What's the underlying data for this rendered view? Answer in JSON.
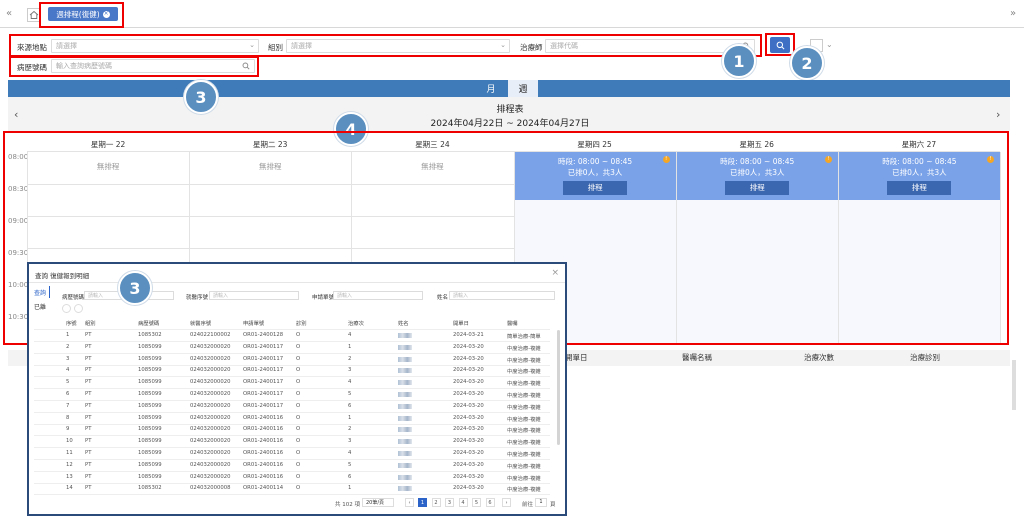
{
  "topbar": {
    "left_arrow": "«",
    "right_arrow": "»",
    "tab_label": "週排程(復健)",
    "tab_close": "×"
  },
  "filters": {
    "source_label": "來源地點",
    "source_placeholder": "請選擇",
    "group_label": "組別",
    "group_placeholder": "請選擇",
    "therapist_label": "治療師",
    "therapist_placeholder": "選擇代碼",
    "chart_label": "病歷號碼",
    "chart_placeholder": "輸入查詢病歷號碼"
  },
  "callouts": [
    "1",
    "2",
    "3",
    "4",
    "3"
  ],
  "view_tabs": {
    "month": "月",
    "week": "週"
  },
  "schedule": {
    "title": "排程表",
    "range": "2024年04月22日 ~ 2024年04月27日",
    "days": [
      "星期一 22",
      "星期二 23",
      "星期三 24",
      "星期四 25",
      "星期五 26",
      "星期六 27"
    ],
    "times": [
      "08:00",
      "08:30",
      "09:00",
      "09:30",
      "10:00",
      "10:30"
    ],
    "no_schedule": "無排程",
    "slot_time": "時段: 08:00 ~ 08:45",
    "slot_count": "已排0人，共3人",
    "slot_button": "排程"
  },
  "bottom_headers": [
    "開單日",
    "醫囑名稱",
    "治療次數",
    "治療診別"
  ],
  "modal": {
    "title": "查詢 復健報到明細",
    "close": "×",
    "side_query": "查詢",
    "side_done": "已離",
    "f1_label": "病歷號碼",
    "f2_label": "就醫序號",
    "f3_label": "申請單號",
    "f4_label": "姓名",
    "placeholder": "請輸入",
    "headers": [
      "序號",
      "組別",
      "病歷號碼",
      "就醫序號",
      "申請單號",
      "診別",
      "治療次",
      "姓名",
      "開單日",
      "醫囑"
    ],
    "rows": [
      [
        "1",
        "PT",
        "1085302",
        "024022100002",
        "OR01-2400128",
        "O",
        "4",
        "2024-03-21",
        "簡單治療-簡單"
      ],
      [
        "2",
        "PT",
        "1085099",
        "024032000020",
        "OR01-2400117",
        "O",
        "1",
        "2024-03-20",
        "中度治療-複雜"
      ],
      [
        "3",
        "PT",
        "1085099",
        "024032000020",
        "OR01-2400117",
        "O",
        "2",
        "2024-03-20",
        "中度治療-複雜"
      ],
      [
        "4",
        "PT",
        "1085099",
        "024032000020",
        "OR01-2400117",
        "O",
        "3",
        "2024-03-20",
        "中度治療-複雜"
      ],
      [
        "5",
        "PT",
        "1085099",
        "024032000020",
        "OR01-2400117",
        "O",
        "4",
        "2024-03-20",
        "中度治療-複雜"
      ],
      [
        "6",
        "PT",
        "1085099",
        "024032000020",
        "OR01-2400117",
        "O",
        "5",
        "2024-03-20",
        "中度治療-複雜"
      ],
      [
        "7",
        "PT",
        "1085099",
        "024032000020",
        "OR01-2400117",
        "O",
        "6",
        "2024-03-20",
        "中度治療-複雜"
      ],
      [
        "8",
        "PT",
        "1085099",
        "024032000020",
        "OR01-2400116",
        "O",
        "1",
        "2024-03-20",
        "中度治療-複雜"
      ],
      [
        "9",
        "PT",
        "1085099",
        "024032000020",
        "OR01-2400116",
        "O",
        "2",
        "2024-03-20",
        "中度治療-複雜"
      ],
      [
        "10",
        "PT",
        "1085099",
        "024032000020",
        "OR01-2400116",
        "O",
        "3",
        "2024-03-20",
        "中度治療-複雜"
      ],
      [
        "11",
        "PT",
        "1085099",
        "024032000020",
        "OR01-2400116",
        "O",
        "4",
        "2024-03-20",
        "中度治療-複雜"
      ],
      [
        "12",
        "PT",
        "1085099",
        "024032000020",
        "OR01-2400116",
        "O",
        "5",
        "2024-03-20",
        "中度治療-複雜"
      ],
      [
        "13",
        "PT",
        "1085099",
        "024032000020",
        "OR01-2400116",
        "O",
        "6",
        "2024-03-20",
        "中度治療-複雜"
      ],
      [
        "14",
        "PT",
        "1085302",
        "024032000008",
        "OR01-2400114",
        "O",
        "1",
        "2024-03-20",
        "中度治療-複雜"
      ]
    ],
    "pager": {
      "total": "共 102 項",
      "per_page": "20筆/頁",
      "pages": [
        "1",
        "2",
        "3",
        "4",
        "5",
        "6"
      ],
      "prev": "‹",
      "next": "›",
      "goto": "前往",
      "goto_value": "1",
      "page_unit": "頁"
    }
  },
  "colors": {
    "accent": "#3e7bb8",
    "highlight": "#e00000",
    "scheduled": "#7aa2e8",
    "callout": "#5a8fbf"
  }
}
